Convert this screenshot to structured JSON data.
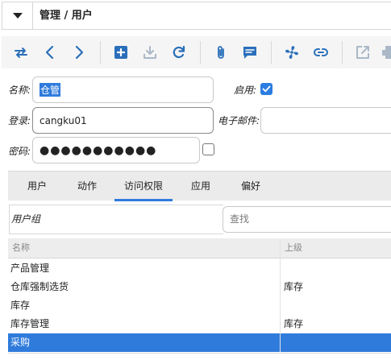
{
  "header": {
    "title": "管理 / 用户",
    "menu_icon": "caret-down-icon"
  },
  "toolbar": {
    "buttons": [
      {
        "name": "switch-view-icon",
        "enabled": true
      },
      {
        "name": "previous-icon",
        "enabled": true
      },
      {
        "name": "next-icon",
        "enabled": true
      },
      {
        "name": "new-record-icon",
        "enabled": true
      },
      {
        "name": "save-icon",
        "enabled": false
      },
      {
        "name": "reload-icon",
        "enabled": true
      },
      {
        "name": "attachment-icon",
        "enabled": true
      },
      {
        "name": "notes-icon",
        "enabled": true
      },
      {
        "name": "action-icon",
        "enabled": true
      },
      {
        "name": "relate-icon",
        "enabled": true
      },
      {
        "name": "open-external-icon",
        "enabled": false
      },
      {
        "name": "print-icon",
        "enabled": false
      }
    ],
    "accent": "#2a6fba",
    "disabled_color": "#aab8c8"
  },
  "form": {
    "name_label": "名称:",
    "name_value": "仓管",
    "active_label": "启用:",
    "active_checked": true,
    "login_label": "登录:",
    "login_value": "cangku01",
    "email_label": "电子邮件:",
    "email_value": "",
    "password_label": "密码:",
    "password_value": "●●●●●●●●●●●",
    "show_password_checked": false
  },
  "tabs": [
    {
      "label": "用户",
      "active": false
    },
    {
      "label": "动作",
      "active": false
    },
    {
      "label": "访问权限",
      "active": true
    },
    {
      "label": "应用",
      "active": false
    },
    {
      "label": "偏好",
      "active": false
    }
  ],
  "groups": {
    "field_label": "用户组",
    "search_placeholder": "查找"
  },
  "table": {
    "columns": [
      "名称",
      "上级"
    ],
    "rows": [
      {
        "name": "产品管理",
        "parent": "",
        "selected": false
      },
      {
        "name": "仓库强制选货",
        "parent": "库存",
        "selected": false
      },
      {
        "name": "库存",
        "parent": "",
        "selected": false
      },
      {
        "name": "库存管理",
        "parent": "库存",
        "selected": false
      },
      {
        "name": "采购",
        "parent": "",
        "selected": true
      }
    ]
  },
  "colors": {
    "selection": "#2f7bdc",
    "checkbox": "#2b7de1"
  }
}
